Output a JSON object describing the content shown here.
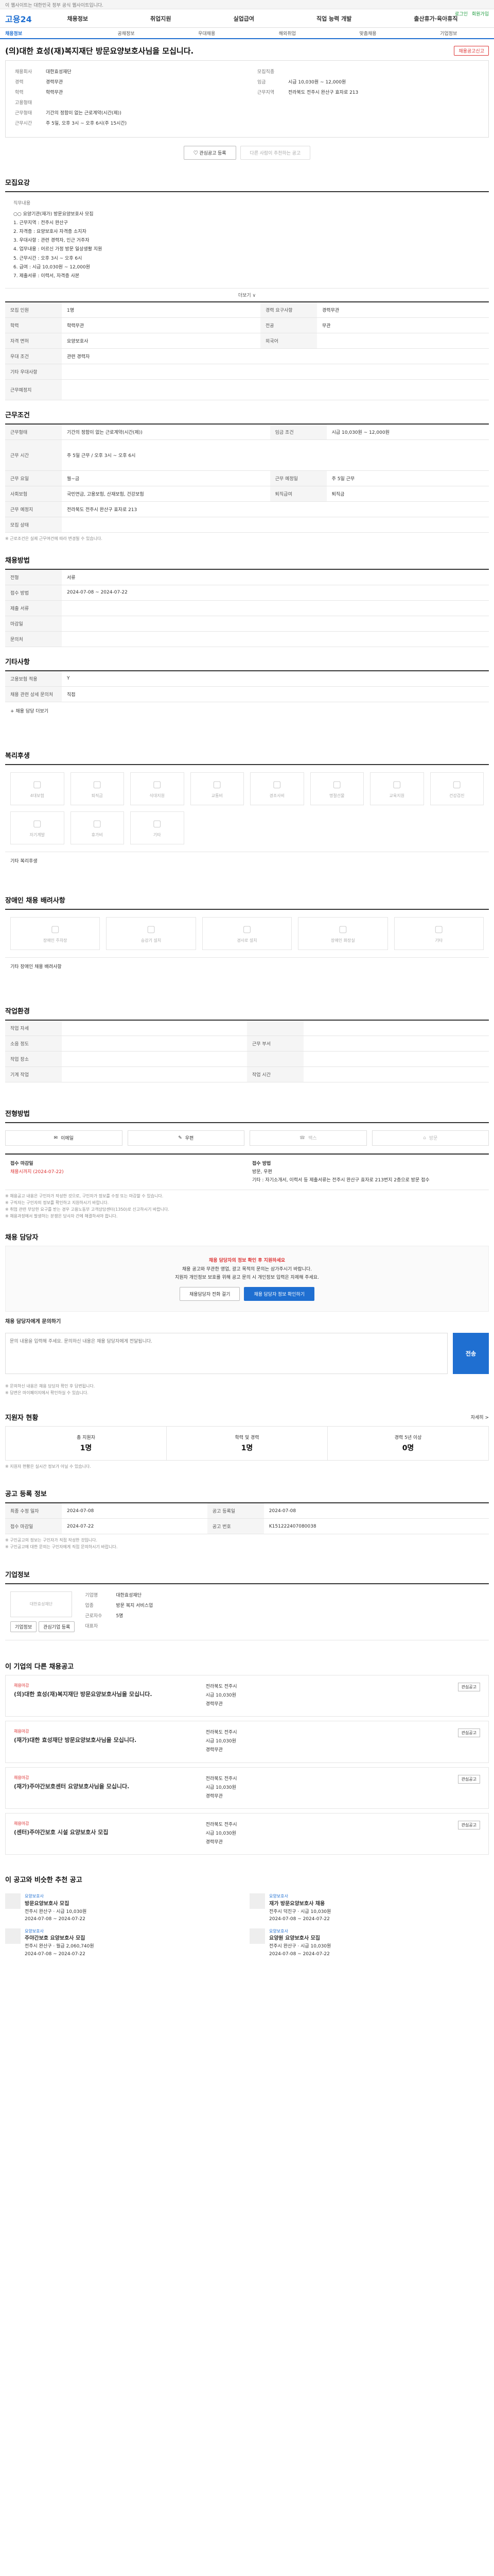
{
  "topbar": {
    "text": "이 웹사이트는 대한민국 정부 공식 웹사이트입니다."
  },
  "header": {
    "logo": "고용24",
    "menus": [
      "채용정보",
      "취업지원",
      "실업급여",
      "직업 능력 개발",
      "출산휴가·육아휴직"
    ],
    "util": [
      "로그인",
      "회원가입"
    ]
  },
  "subnav": [
    "채용정보",
    "공채정보",
    "우대채용",
    "해외취업",
    "맞춤채용",
    "기업정보"
  ],
  "posting": {
    "title": "(의)대한 효성(재)복지재단 방문요양보호사님을 모십니다.",
    "report_btn": "채용공고신고",
    "left": [
      {
        "k": "채용회사",
        "v": "대한효성재단"
      },
      {
        "k": "경력",
        "v": "경력무관"
      },
      {
        "k": "학력",
        "v": "학력무관"
      },
      {
        "k": "고용형태",
        "v": ""
      },
      {
        "k": "근무형태",
        "v": "기간의 정함이 없는 근로계약(시간(제))"
      },
      {
        "k": "근무시간",
        "v": "주 5일, 오후 3시 ~ 오후 6시(주 15시간)"
      }
    ],
    "right": [
      {
        "k": "모집직종",
        "v": ""
      },
      {
        "k": "임금",
        "v": "시급 10,030원 ~ 12,000원"
      },
      {
        "k": "근무지역",
        "v": "전라북도 전주시 완산구 효자로 213"
      },
      {
        "k": "",
        "v": ""
      }
    ],
    "btn_apply": "관심공고 등록",
    "btn_share": "다른 사람이 추천하는 공고"
  },
  "sections": {
    "recruit": "모집요강",
    "duty_title": "직무내용",
    "duty_lines": [
      "○○ 요양기관(재가) 방문요양보호사 모집",
      "1. 근무지역 : 전주시 완산구",
      "2. 자격증 : 요양보호사 자격증 소지자",
      "3. 우대사항 : 관련 경력자, 인근 거주자",
      "4. 업무내용 : 어르신 가정 방문 일상생활 지원",
      "5. 근무시간 : 오후 3시 ~ 오후 6시",
      "6. 급여 : 시급 10,030원 ~ 12,000원",
      "7. 제출서류 : 이력서, 자격증 사본"
    ],
    "more": "더보기 ∨",
    "recruit_table": [
      {
        "k": "모집 인원",
        "v": "1명",
        "k2": "경력 요구사항",
        "v2": "경력무관"
      },
      {
        "k": "학력",
        "v": "학력무관",
        "k2": "전공",
        "v2": "무관"
      },
      {
        "k": "자격 면허",
        "v": "요양보호사",
        "k2": "외국어",
        "v2": ""
      },
      {
        "k": "우대 조건",
        "v": "관련 경력자",
        "k2": "",
        "v2": ""
      },
      {
        "k": "기타 우대사항",
        "v": "",
        "k2": "",
        "v2": ""
      },
      {
        "k": "근무예정지",
        "v": "",
        "k2": "",
        "v2": ""
      }
    ],
    "condition": "근무조건",
    "condition_table": [
      {
        "k": "근무형태",
        "v": "기간의 정함이 없는 근로계약(시간(제))",
        "k2": "임금 조건",
        "v2": "시급 10,030원 ~ 12,000원"
      },
      {
        "k": "근무 시간",
        "v": "주 5일 근무 / 오후 3시 ~ 오후 6시",
        "k2": "",
        "v2": ""
      },
      {
        "k": "근무 요일",
        "v": "월~금",
        "k2": "근무 예정일",
        "v2": "주 5일 근무"
      },
      {
        "k": "사회보험",
        "v": "국민연금, 고용보험, 산재보험, 건강보험",
        "k2": "퇴직급여",
        "v2": "퇴직금"
      },
      {
        "k": "근무 예정지",
        "v": "전라북도 전주시 완산구 효자로 213",
        "k2": "",
        "v2": ""
      },
      {
        "k": "모집 상태",
        "v": "",
        "k2": "",
        "v2": ""
      }
    ],
    "condition_note": "※ 근로조건은 실제 근무여건에 따라 변경될 수 있습니다.",
    "apply_method": "채용방법",
    "apply_table": [
      {
        "k": "전형",
        "v": "서류"
      },
      {
        "k": "접수 방법",
        "v": ""
      },
      {
        "k": "제출 서류",
        "v": ""
      },
      {
        "k": "마감일",
        "v": ""
      },
      {
        "k": "문의처",
        "v": ""
      }
    ],
    "apply_dates": "2024-07-08 ~ 2024-07-22",
    "etc": "기타사항",
    "etc_table": [
      {
        "k": "고용보험 적용",
        "v": "Y"
      },
      {
        "k": "채용 관련 상세 문의처",
        "v": "직접"
      }
    ],
    "etc_more": "+ 채용 담당 더보기",
    "welfare": "복리후생",
    "welfare_items": [
      "4대보험",
      "퇴직금",
      "식대지원",
      "교통비",
      "경조사비",
      "명절선물",
      "교육지원",
      "건강검진",
      "자기계발",
      "휴가비",
      "기타"
    ],
    "welfare_note": "기타 복리후생",
    "disability": "장애인 채용 배려사항",
    "disability_items": [
      "장애인 주차장",
      "승강기 설치",
      "경사로 설치",
      "장애인 화장실",
      "기타"
    ],
    "disability_note": "기타 장애인 채용 배려사항",
    "work_env": "작업환경",
    "work_table": [
      {
        "k": "작업 자세",
        "v": "",
        "k2": "",
        "v2": ""
      },
      {
        "k": "소음 정도",
        "v": "",
        "k2": "근무 부서",
        "v2": ""
      },
      {
        "k": "작업 장소",
        "v": "",
        "k2": "",
        "v2": ""
      },
      {
        "k": "기계 작업",
        "v": "",
        "k2": "작업 시간",
        "v2": ""
      }
    ],
    "method": "전형방법",
    "methods": [
      "이메일",
      "우편",
      "팩스",
      "방문"
    ],
    "proc_left_title": "접수 마감일",
    "proc_left_value": "채용시까지 (2024-07-22)",
    "proc_right_title": "접수 방법",
    "proc_right_lines": [
      "방문, 우편",
      "기타 : 자기소개서, 이력서 등 제출서류는 전주시 완산구 효자로 213번지 2층으로 방문 접수"
    ],
    "proc_notes": [
      "※ 채용공고 내용은 구인자가 작성한 것으로, 구인자가 정보를 수정 또는 마감할 수 있습니다.",
      "※ 구직자는 구인자의 정보를 확인하고 지원하시기 바랍니다.",
      "※ 취업 관련 부당한 요구를 받는 경우 고용노동부 고객상담센터(1350)로 신고하시기 바랍니다.",
      "※ 채용과정에서 발생하는 분쟁은 당사자 간에 해결하셔야 합니다."
    ],
    "staff": "채용 담당자",
    "warn_lines": [
      "채용 담당자의 정보 확인 후 지원하세요",
      "채용 공고와 무관한 영업, 광고 목적의 문의는 삼가주시기 바랍니다.",
      "지원자 개인정보 보호를 위해 공고 문의 시 개인정보 입력은 자제해 주세요."
    ],
    "warn_btn1": "채용담당자 전화 걸기",
    "warn_btn2": "채용 담당자 정보 확인하기",
    "inquiry_title": "채용 담당자에게 문의하기",
    "inquiry_placeholder": "문의 내용을 입력해 주세요. 문의하신 내용은 채용 담당자에게 전달됩니다.",
    "inquiry_btn": "전송",
    "inquiry_notes": [
      "※ 문의하신 내용은 채용 담당자 확인 후 답변됩니다.",
      "※ 답변은 마이페이지에서 확인하실 수 있습니다."
    ],
    "applicant": "지원자 현황",
    "applicant_link": "자세히 >",
    "stats": [
      {
        "label": "총 지원자",
        "num": "1명"
      },
      {
        "label": "학력 및 경력",
        "num": "1명"
      },
      {
        "label": "경력 5년 이상",
        "num": "0명"
      }
    ],
    "stats_note": "※ 지원자 현황은 실시간 정보가 아닐 수 있습니다.",
    "reg": "공고 등록 정보",
    "reg_table": [
      {
        "k": "최종 수정 일자",
        "v": "2024-07-08",
        "k2": "공고 등록일",
        "v2": "2024-07-08"
      },
      {
        "k": "접수 마감일",
        "v": "2024-07-22",
        "k2": "공고 번호",
        "v2": "K151222407080038"
      }
    ],
    "reg_notes": [
      "※ 구인공고의 정보는 구인자가 직접 작성한 것입니다.",
      "※ 구인공고에 대한 문의는 구인자에게 직접 문의하시기 바랍니다."
    ],
    "company": "기업정보",
    "company_name": "대한효성재단",
    "company_rows": [
      {
        "k": "기업명",
        "v": "대한효성재단"
      },
      {
        "k": "업종",
        "v": "방문 복지 서비스업"
      },
      {
        "k": "근로자수",
        "v": "5명"
      },
      {
        "k": "대표자",
        "v": ""
      }
    ],
    "company_btn1": "기업정보",
    "company_btn2": "관심기업 등록",
    "similar": "이 기업의 다른 채용공고",
    "similar_items": [
      {
        "badge": "채용마감",
        "title": "(의)대한 효성(재)복지재단 방문요양보호사님을 모십니다.",
        "l1": "전라북도 전주시",
        "l2": "시급 10,030원",
        "l3": "경력무관",
        "star": "관심공고"
      },
      {
        "badge": "채용마감",
        "title": "(재가)대한 효성재단 방문요양보호사님을 모십니다.",
        "l1": "전라북도 전주시",
        "l2": "시급 10,030원",
        "l3": "경력무관",
        "star": "관심공고"
      },
      {
        "badge": "채용마감",
        "title": "(재가)주야간보호센터 요양보호사님을 모십니다.",
        "l1": "전라북도 전주시",
        "l2": "시급 10,030원",
        "l3": "경력무관",
        "star": "관심공고"
      },
      {
        "badge": "채용마감",
        "title": "(센터)주야간보호 시설 요양보호사 모집",
        "l1": "전라북도 전주시",
        "l2": "시급 10,030원",
        "l3": "경력무관",
        "star": "관심공고"
      }
    ],
    "rec": "이 공고와 비슷한 추천 공고",
    "rec_items": [
      {
        "tag": "요양보호사",
        "title": "방문요양보호사 모집",
        "sub": "전주시 완산구 · 시급 10,030원",
        "date": "2024-07-08 ~ 2024-07-22"
      },
      {
        "tag": "요양보호사",
        "title": "재가 방문요양보호사 채용",
        "sub": "전주시 덕진구 · 시급 10,030원",
        "date": "2024-07-08 ~ 2024-07-22"
      },
      {
        "tag": "요양보호사",
        "title": "주야간보호 요양보호사 모집",
        "sub": "전주시 완산구 · 월급 2,060,740원",
        "date": "2024-07-08 ~ 2024-07-22"
      },
      {
        "tag": "요양보호사",
        "title": "요양원 요양보호사 모집",
        "sub": "전주시 완산구 · 시급 10,030원",
        "date": "2024-07-08 ~ 2024-07-22"
      }
    ]
  }
}
